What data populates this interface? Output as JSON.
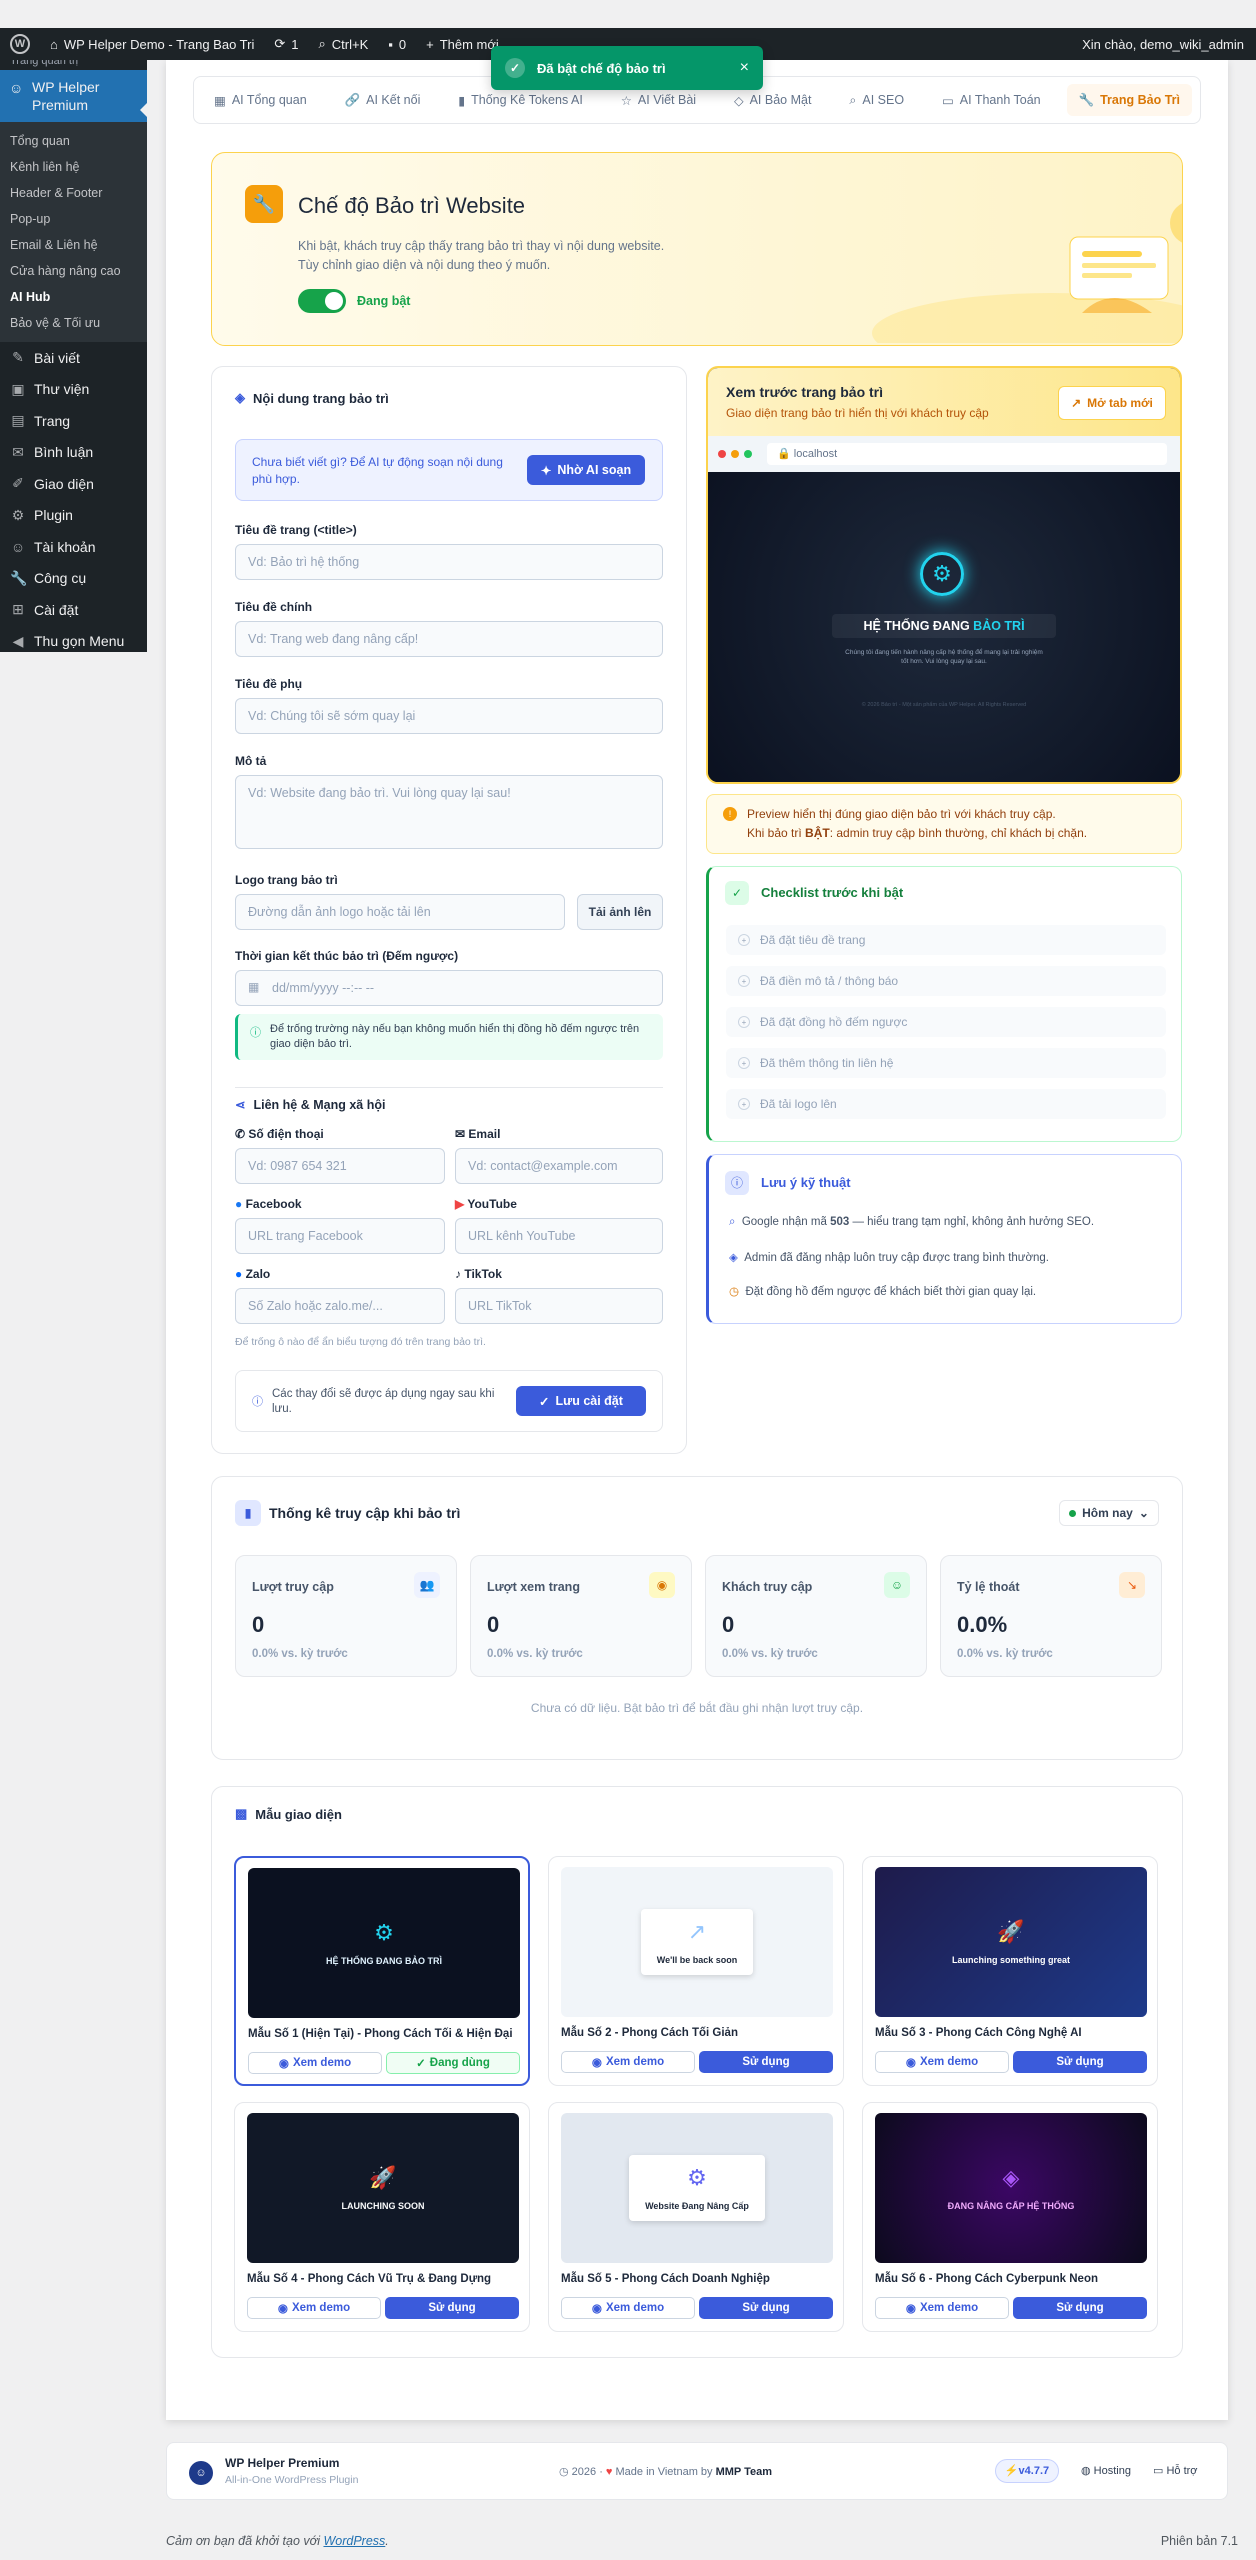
{
  "admin_bar": {
    "site": "WP Helper Demo - Trang Bao Tri",
    "updates": "1",
    "shortcut": "Ctrl+K",
    "comments": "0",
    "new": "Thêm mới",
    "greeting": "Xin chào, demo_wiki_admin"
  },
  "toast": {
    "text": "Đã bật chế độ bảo trì",
    "close": "×"
  },
  "sidebar": {
    "cut": "Trang quản trị",
    "current": "WP Helper Premium",
    "submenu": [
      "Tổng quan",
      "Kênh liên hệ",
      "Header & Footer",
      "Pop-up",
      "Email & Liên hệ",
      "Cửa hàng nâng cao",
      "AI Hub",
      "Bảo vệ & Tối ưu"
    ],
    "items": [
      {
        "icon": "✎",
        "label": "Bài viết"
      },
      {
        "icon": "▣",
        "label": "Thư viện"
      },
      {
        "icon": "▤",
        "label": "Trang"
      },
      {
        "icon": "✉",
        "label": "Bình luận"
      },
      {
        "icon": "✐",
        "label": "Giao diện"
      },
      {
        "icon": "⚙",
        "label": "Plugin"
      },
      {
        "icon": "☺",
        "label": "Tài khoản"
      },
      {
        "icon": "🔧",
        "label": "Công cụ"
      },
      {
        "icon": "⊞",
        "label": "Cài đặt"
      },
      {
        "icon": "◀",
        "label": "Thu gọn Menu"
      }
    ]
  },
  "tabs": [
    {
      "icon": "▦",
      "label": "AI Tổng quan"
    },
    {
      "icon": "🔗",
      "label": "AI Kết nối"
    },
    {
      "icon": "▮",
      "label": "Thống Kê Tokens AI"
    },
    {
      "icon": "☆",
      "label": "AI Viết Bài"
    },
    {
      "icon": "◇",
      "label": "AI Bảo Mật"
    },
    {
      "icon": "⌕",
      "label": "AI SEO"
    },
    {
      "icon": "▭",
      "label": "AI Thanh Toán"
    },
    {
      "icon": "🔧",
      "label": "Trang Bảo Trì"
    }
  ],
  "hero": {
    "title": "Chế độ Bảo trì Website",
    "desc1": "Khi bật, khách truy cập thấy trang bảo trì thay vì nội dung website.",
    "desc2": "Tùy chỉnh giao diện và nội dung theo ý muốn.",
    "toggle_label": "Đang bật"
  },
  "form": {
    "heading": "Nội dung trang bảo trì",
    "ai_hint": "Chưa biết viết gì? Để AI tự động soạn nội dung phù hợp.",
    "ai_button": "Nhờ AI soạn",
    "title_tag_label": "Tiêu đề trang (<title>)",
    "title_tag_ph": "Vd: Bảo trì hệ thống",
    "main_title_label": "Tiêu đề chính",
    "main_title_ph": "Vd: Trang web đang nâng cấp!",
    "sub_title_label": "Tiêu đề phụ",
    "sub_title_ph": "Vd: Chúng tôi sẽ sớm quay lại",
    "desc_label": "Mô tả",
    "desc_ph": "Vd: Website đang bảo trì. Vui lòng quay lại sau!",
    "logo_label": "Logo trang bảo trì",
    "logo_ph": "Đường dẫn ảnh logo hoặc tải lên",
    "upload": "Tải ảnh lên",
    "countdown_label": "Thời gian kết thúc bảo trì (Đếm ngược)",
    "countdown_ph": "dd/mm/yyyy --:-- --",
    "countdown_note": "Để trống trường này nếu bạn không muốn hiển thị đồng hồ đếm ngược trên giao diện bảo trì.",
    "contact_heading": "Liên hệ & Mạng xã hội",
    "phone_label": "Số điện thoại",
    "phone_ph": "Vd: 0987 654 321",
    "email_label": "Email",
    "email_ph": "Vd: contact@example.com",
    "fb_label": "Facebook",
    "fb_ph": "URL trang Facebook",
    "yt_label": "YouTube",
    "yt_ph": "URL kênh YouTube",
    "zalo_label": "Zalo",
    "zalo_ph": "Số Zalo hoặc zalo.me/...",
    "tiktok_label": "TikTok",
    "tiktok_ph": "URL TikTok",
    "social_note": "Để trống ô nào để ẩn biểu tượng đó trên trang bảo trì.",
    "save_note": "Các thay đổi sẽ được áp dụng ngay sau khi lưu.",
    "save": "Lưu cài đặt"
  },
  "preview": {
    "title": "Xem trước trang bảo trì",
    "subtitle": "Giao diện trang bảo trì hiển thị với khách truy cập",
    "open": "Mở tab mới",
    "url": "localhost",
    "heading": "HỆ THỐNG ĐANG BẢO TRÌ",
    "highlight": "BẢO TRÌ",
    "body": "Chúng tôi đang tiến hành nâng cấp hệ thống để mang lại trải nghiệm tốt hơn. Vui lòng quay lại sau.",
    "footer": "© 2026 Bảo trì - Một sản phẩm của WP Helper. All Rights Reserved",
    "warn1": "Preview hiển thị đúng giao diện bảo trì với khách truy cập.",
    "warn2_pre": "Khi bảo trì ",
    "warn2_bold": "BẬT",
    "warn2_post": ": admin truy cập bình thường, chỉ khách bị chặn."
  },
  "checklist": {
    "title": "Checklist trước khi bật",
    "items": [
      "Đã đặt tiêu đề trang",
      "Đã điền mô tả / thông báo",
      "Đã đặt đồng hồ đếm ngược",
      "Đã thêm thông tin liên hệ",
      "Đã tải logo lên"
    ]
  },
  "tech": {
    "title": "Lưu ý kỹ thuật",
    "n1_pre": "Google nhận mã ",
    "n1_bold": "503",
    "n1_post": " — hiểu trang tạm nghỉ, không ảnh hưởng SEO.",
    "n2": "Admin đã đăng nhập luôn truy cập được trang bình thường.",
    "n3": "Đặt đồng hồ đếm ngược để khách biết thời gian quay lại."
  },
  "stats": {
    "title": "Thống kê truy cập khi bảo trì",
    "range": "Hôm nay",
    "cards": [
      {
        "label": "Lượt truy cập",
        "value": "0",
        "change": "0.0% vs. kỳ trước",
        "icon": "👥",
        "color": "#6366f1",
        "bg": "#eef2ff"
      },
      {
        "label": "Lượt xem trang",
        "value": "0",
        "change": "0.0% vs. kỳ trước",
        "icon": "◉",
        "color": "#d97706",
        "bg": "#fef9c3"
      },
      {
        "label": "Khách truy cập",
        "value": "0",
        "change": "0.0% vs. kỳ trước",
        "icon": "☺",
        "color": "#16a34a",
        "bg": "#dcfce7"
      },
      {
        "label": "Tỷ lệ thoát",
        "value": "0.0%",
        "change": "0.0% vs. kỳ trước",
        "icon": "↘",
        "color": "#ea580c",
        "bg": "#ffedd5"
      }
    ],
    "empty": "Chưa có dữ liệu. Bật bảo trì để bắt đầu ghi nhận lượt truy cập."
  },
  "templates": {
    "title": "Mẫu giao diện",
    "demo": "Xem demo",
    "use": "Sử dụng",
    "active": "Đang dùng",
    "items": [
      {
        "name": "Mẫu Số 1 (Hiện Tại) - Phong Cách Tối & Hiện Đại",
        "thumb": "HỆ THỐNG ĐANG BẢO TRÌ"
      },
      {
        "name": "Mẫu Số 2 - Phong Cách Tối Giản",
        "thumb": "We'll be back soon"
      },
      {
        "name": "Mẫu Số 3 - Phong Cách Công Nghệ AI",
        "thumb": "Launching something great"
      },
      {
        "name": "Mẫu Số 4 - Phong Cách Vũ Trụ & Đang Dựng",
        "thumb": "LAUNCHING SOON"
      },
      {
        "name": "Mẫu Số 5 - Phong Cách Doanh Nghiệp",
        "thumb": "Website Đang Nâng Cấp"
      },
      {
        "name": "Mẫu Số 6 - Phong Cách Cyberpunk Neon",
        "thumb": "ĐANG NÂNG CẤP HỆ THỐNG"
      }
    ]
  },
  "plugin_footer": {
    "name": "WP Helper Premium",
    "sub": "All-in-One WordPress Plugin",
    "year": "2026",
    "made": "Made in Vietnam by",
    "team": "MMP Team",
    "version": "v4.7.7",
    "hosting": "Hosting",
    "support": "Hỗ trợ"
  },
  "wp_footer": {
    "thanks_pre": "Cảm ơn bạn đã khởi tạo với ",
    "thanks_link": "WordPress",
    "thanks_post": ".",
    "version": "Phiên bản 7.1"
  }
}
